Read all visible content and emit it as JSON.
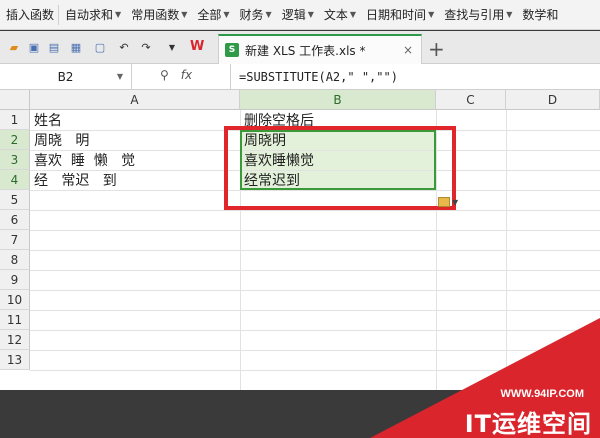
{
  "ribbon": {
    "items": [
      {
        "label": "插入函数",
        "dropdown": false
      },
      {
        "label": "自动求和",
        "dropdown": true
      },
      {
        "label": "常用函数",
        "dropdown": true
      },
      {
        "label": "全部",
        "dropdown": true
      },
      {
        "label": "财务",
        "dropdown": true
      },
      {
        "label": "逻辑",
        "dropdown": true
      },
      {
        "label": "文本",
        "dropdown": true
      },
      {
        "label": "日期和时间",
        "dropdown": true
      },
      {
        "label": "查找与引用",
        "dropdown": true
      },
      {
        "label": "数学和",
        "dropdown": false
      }
    ]
  },
  "tabbar": {
    "app_logo": "W",
    "tab_label": "新建 XLS 工作表.xls *",
    "tab_close": "×",
    "new_tab": "+"
  },
  "formula_bar": {
    "cell_ref": "B2",
    "fx": "fx",
    "formula": "=SUBSTITUTE(A2,\" \",\"\")"
  },
  "sheet": {
    "columns": [
      "A",
      "B",
      "C",
      "D"
    ],
    "rows": [
      "1",
      "2",
      "3",
      "4",
      "5",
      "6",
      "7",
      "8",
      "9",
      "10",
      "11",
      "12",
      "13"
    ],
    "cells": {
      "A1": "姓名",
      "A2": "周晓   明",
      "A3": "喜欢  睡  懒   觉",
      "A4": "经   常迟   到",
      "B1": "删除空格后",
      "B2": "周晓明",
      "B3": "喜欢睡懒觉",
      "B4": "经常迟到"
    }
  },
  "watermark": {
    "url": "WWW.94IP.COM",
    "title": "IT运维空间"
  },
  "colors": {
    "selection_fill": "#e4f1da",
    "selection_border": "#3a9a3a",
    "highlight_box": "#e0262b",
    "watermark_red": "#d9252b"
  }
}
